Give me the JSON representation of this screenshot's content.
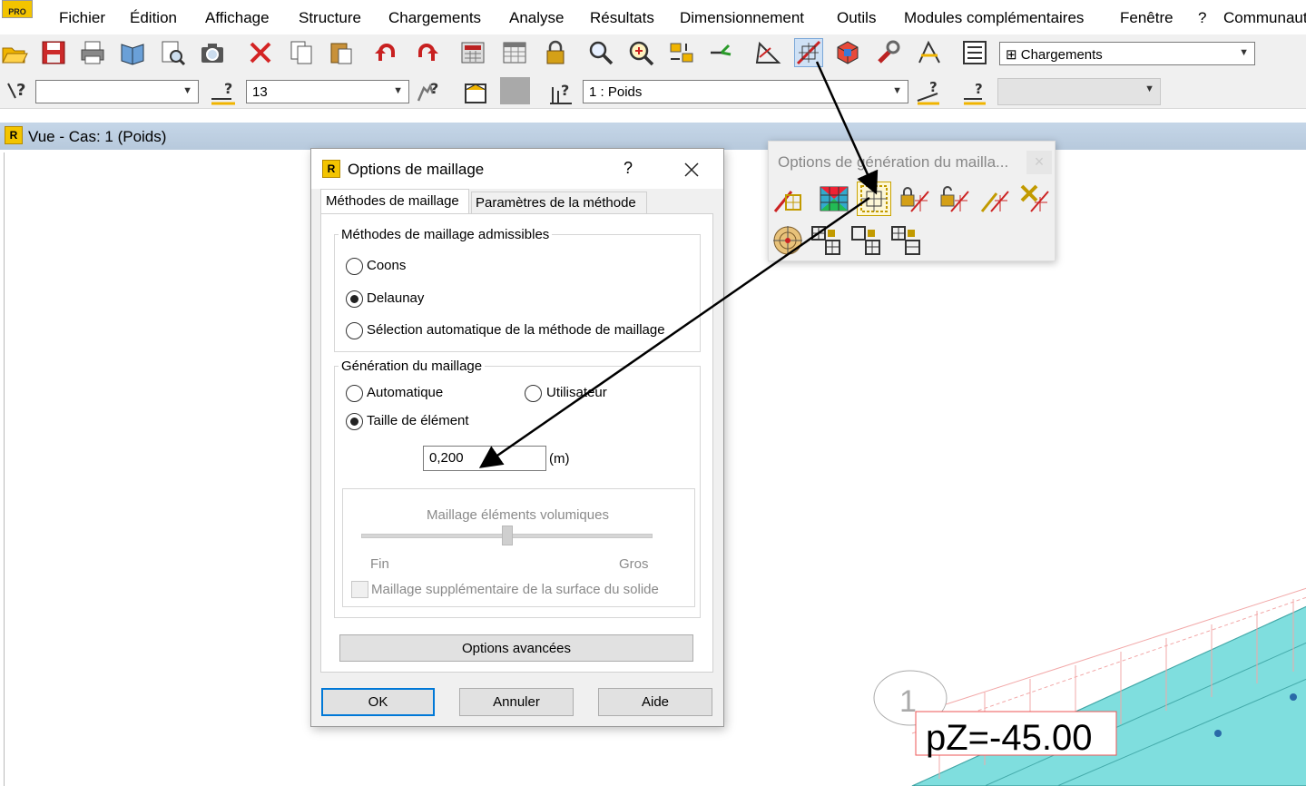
{
  "menu": [
    "Fichier",
    "Édition",
    "Affichage",
    "Structure",
    "Chargements",
    "Analyse",
    "Résultats",
    "Dimensionnement",
    "Outils",
    "Modules complémentaires",
    "Fenêtre",
    "?",
    "Communauté"
  ],
  "app_badge": "PRO",
  "toolbar": {
    "loads_combo": "Chargements",
    "combo_empty": "",
    "num_combo": "13",
    "case_combo": "1 : Poids"
  },
  "view": {
    "title": "Vue - Cas: 1 (Poids)",
    "node_label": "1",
    "load_label": "pZ=-45.00"
  },
  "dialog": {
    "title": "Options de maillage",
    "help": "?",
    "tabs": [
      "Méthodes de maillage",
      "Paramètres de la méthode"
    ],
    "group1": {
      "title": "Méthodes de maillage admissibles",
      "options": [
        "Coons",
        "Delaunay",
        "Sélection automatique de la méthode de maillage"
      ],
      "selected": "Delaunay"
    },
    "group2": {
      "title": "Génération du maillage",
      "auto": "Automatique",
      "user": "Utilisateur",
      "size": "Taille de élément",
      "selected": "Taille de élément",
      "size_value": "0,200",
      "unit": "(m)"
    },
    "group3": {
      "title": "Maillage éléments volumiques",
      "fine": "Fin",
      "coarse": "Gros",
      "checkbox": "Maillage supplémentaire de la surface du solide",
      "slider_level": 0.5
    },
    "advanced_button": "Options avancées",
    "ok_button": "OK",
    "cancel_button": "Annuler",
    "help_button": "Aide"
  },
  "palette": {
    "title": "Options de génération du mailla...",
    "close": "×"
  },
  "colors": {
    "accent_red": "#cc2a2a",
    "accent_yellow": "#f0b400",
    "mesh_cyan": "#7fdede",
    "title_blue": "#c5d6e8"
  }
}
